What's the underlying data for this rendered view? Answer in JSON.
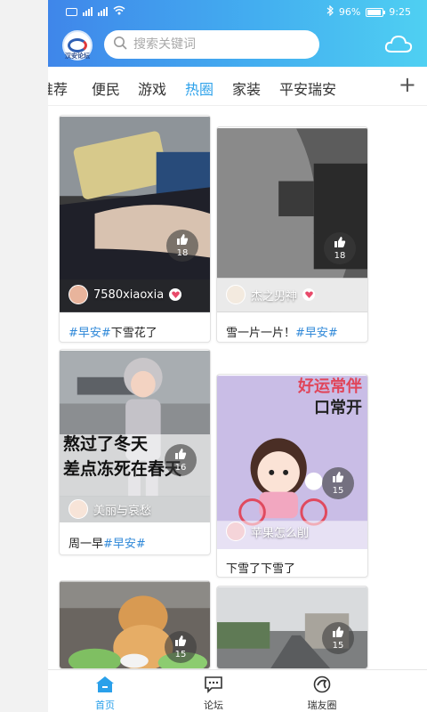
{
  "status_bar": {
    "battery": "96%",
    "time": "9:25"
  },
  "header": {
    "logo_text": "汉安论坛",
    "search_placeholder": "搜索关键词"
  },
  "tabs": [
    "推荐",
    "便民",
    "游戏",
    "热圈",
    "家装",
    "平安瑞安"
  ],
  "active_tab": "热圈",
  "add_tab_label": "+",
  "posts": [
    {
      "user": "7580xiaoxia",
      "likes": "18",
      "caption_tag": "#早安#",
      "caption_text": "下雪花了"
    },
    {
      "user": "杰之男神",
      "likes": "18",
      "caption_text": "雪一片一片！",
      "caption_tag": "#早安#"
    },
    {
      "user": "美丽与哀愁",
      "likes": "16",
      "caption_text": "周一早",
      "caption_tag": "#早安#",
      "overlay_line1": "熬过了冬天",
      "overlay_line2": "差点冻死在春天"
    },
    {
      "user": "苹果怎么削",
      "likes": "15",
      "caption_text": "下雪了下雪了",
      "overlay_line1": "好运常伴",
      "overlay_line2": "口常开"
    },
    {
      "likes": "15"
    },
    {
      "likes": "15"
    }
  ],
  "bottom_nav": [
    {
      "label": "首页"
    },
    {
      "label": "论坛"
    },
    {
      "label": "瑞友圈"
    }
  ],
  "colors": {
    "accent": "#2aa0ea",
    "tag": "#2f88d8",
    "header_start": "#3f86ea",
    "header_end": "#4fd0f2"
  }
}
